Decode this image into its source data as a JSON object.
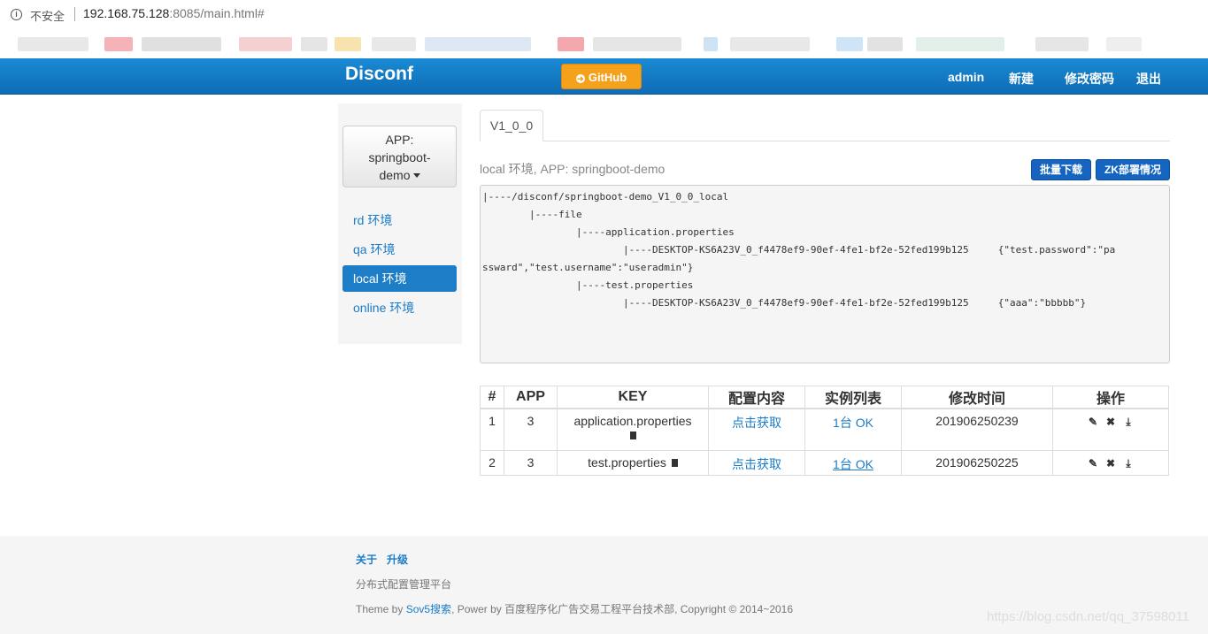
{
  "browser": {
    "insecure_label": "不安全",
    "url_host": "192.168.75.128",
    "url_rest": ":8085/main.html#"
  },
  "navbar": {
    "brand": "Disconf",
    "github_label": "GitHub",
    "user": "admin",
    "new_label": "新建",
    "change_password_label": "修改密码",
    "logout_label": "退出"
  },
  "sidebar": {
    "app_prefix": "APP:",
    "app_name_line1": "springboot-",
    "app_name_line2": "demo",
    "envs": [
      {
        "label": "rd 环境"
      },
      {
        "label": "qa 环境"
      },
      {
        "label": "local 环境"
      },
      {
        "label": "online 环境"
      }
    ]
  },
  "main": {
    "tab_label": "V1_0_0",
    "env_title": "local 环境, APP: springboot-demo",
    "batch_download_label": "批量下载",
    "zk_status_label": "ZK部署情况",
    "tree_lines": [
      "|----/disconf/springboot-demo_V1_0_0_local",
      "        |----file",
      "                |----application.properties",
      "                        |----DESKTOP-KS6A23V_0_f4478ef9-90ef-4fe1-bf2e-52fed199b125     {\"test.password\":\"pa",
      "ssward\",\"test.username\":\"useradmin\"}",
      "                |----test.properties",
      "                        |----DESKTOP-KS6A23V_0_f4478ef9-90ef-4fe1-bf2e-52fed199b125     {\"aaa\":\"bbbbb\"}"
    ],
    "table": {
      "headers": [
        "#",
        "APP",
        "KEY",
        "配置内容",
        "实例列表",
        "修改时间",
        "操作"
      ],
      "rows": [
        {
          "num": "1",
          "app": "3",
          "key": "application.properties",
          "content": "点击获取",
          "instances": "1台 OK",
          "time": "201906250239"
        },
        {
          "num": "2",
          "app": "3",
          "key": "test.properties",
          "content": "点击获取",
          "instances": "1台 OK",
          "time": "201906250225"
        }
      ]
    }
  },
  "footer": {
    "about": "关于",
    "upgrade": "升级",
    "desc": "分布式配置管理平台",
    "theme_prefix": "Theme by ",
    "theme_link": "Sov5搜索",
    "powered": ",   Power by 百度程序化广告交易工程平台技术部,   Copyright © 2014~2016",
    "watermark": "https://blog.csdn.net/qq_37598011"
  },
  "colors": {
    "navbar": "#1a8ad4",
    "github": "#f5a11c",
    "active_env": "#1d7ec7",
    "link": "#1a7cc8",
    "action_button": "#1565c0"
  }
}
